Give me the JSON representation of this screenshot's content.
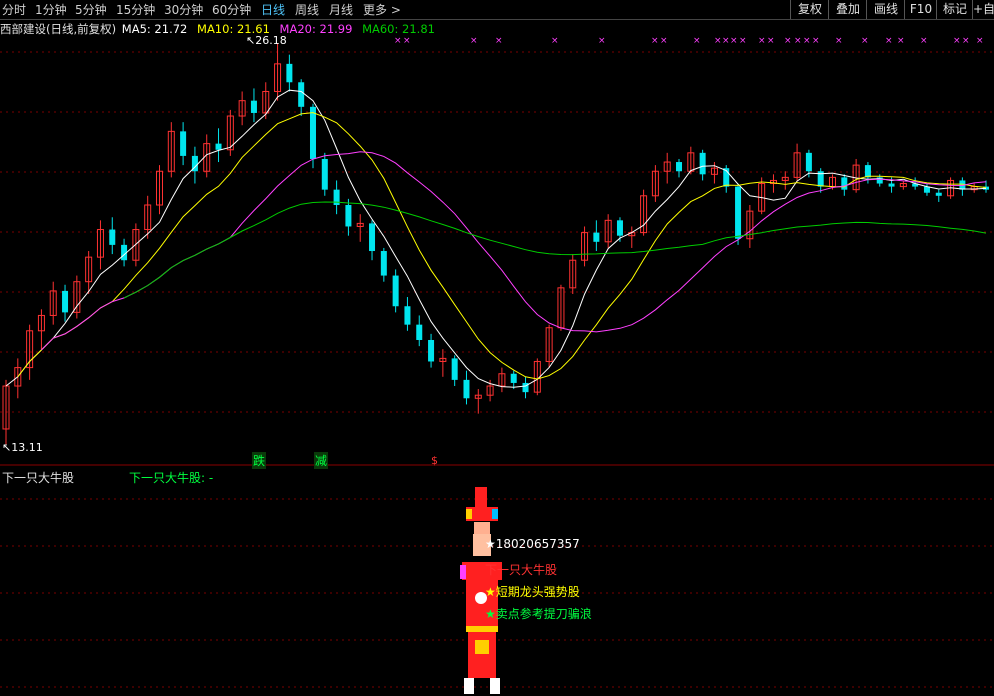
{
  "toolbar": {
    "periods": [
      "分时",
      "1分钟",
      "5分钟",
      "15分钟",
      "30分钟",
      "60分钟",
      "日线",
      "周线",
      "月线",
      "更多 >"
    ],
    "active_period": "日线",
    "right_buttons": [
      "复权",
      "叠加",
      "画线",
      "F10",
      "标记",
      "+自"
    ]
  },
  "info": {
    "stock": "西部建设(日线,前复权)",
    "ma5": "MA5: 21.72",
    "ma10": "MA10: 21.61",
    "ma20": "MA20: 21.99",
    "ma60": "MA60: 21.81"
  },
  "annotations": {
    "high": "26.18",
    "low": "13.11",
    "signal_die": "跌",
    "signal_jian": "减",
    "signal_dollar": "$"
  },
  "lower_panel": {
    "title": "下一只大牛股",
    "indicator": "下一只大牛股: -",
    "phone": "18020657357",
    "text1": "下一只大牛股",
    "text2": "短期龙头强势股",
    "text3": "卖点参考提刀骗浪"
  },
  "colors": {
    "up": "#ff3232",
    "down": "#00e5ee",
    "ma5": "#ffffff",
    "ma10": "#ffff00",
    "ma20": "#ff40ff",
    "ma60": "#00cc00",
    "grid": "#7a0000",
    "marker": "#ff40ff"
  },
  "chart_data": {
    "type": "candlestick",
    "series": [
      {
        "name": "MA5",
        "value": 21.72
      },
      {
        "name": "MA10",
        "value": 21.61
      },
      {
        "name": "MA20",
        "value": 21.99
      },
      {
        "name": "MA60",
        "value": 21.81
      }
    ],
    "high": 26.18,
    "low": 13.11,
    "candles": [
      [
        13.6,
        15.2,
        13.1,
        15.0
      ],
      [
        15.0,
        15.9,
        14.6,
        15.6
      ],
      [
        15.6,
        17.0,
        15.2,
        16.8
      ],
      [
        16.8,
        17.5,
        16.2,
        17.3
      ],
      [
        17.3,
        18.4,
        17.0,
        18.1
      ],
      [
        18.1,
        18.3,
        17.1,
        17.4
      ],
      [
        17.4,
        18.6,
        17.2,
        18.4
      ],
      [
        18.4,
        19.4,
        18.0,
        19.2
      ],
      [
        19.2,
        20.4,
        18.8,
        20.1
      ],
      [
        20.1,
        20.5,
        19.3,
        19.6
      ],
      [
        19.6,
        19.8,
        18.9,
        19.1
      ],
      [
        19.1,
        20.3,
        18.9,
        20.1
      ],
      [
        20.1,
        21.2,
        19.8,
        20.9
      ],
      [
        20.9,
        22.2,
        20.6,
        22.0
      ],
      [
        22.0,
        23.6,
        21.8,
        23.3
      ],
      [
        23.3,
        23.6,
        22.2,
        22.5
      ],
      [
        22.5,
        22.8,
        21.6,
        22.0
      ],
      [
        22.0,
        23.2,
        21.8,
        22.9
      ],
      [
        22.9,
        23.4,
        22.3,
        22.7
      ],
      [
        22.7,
        24.0,
        22.5,
        23.8
      ],
      [
        23.8,
        24.6,
        23.5,
        24.3
      ],
      [
        24.3,
        24.7,
        23.6,
        23.9
      ],
      [
        23.9,
        24.9,
        23.7,
        24.6
      ],
      [
        24.6,
        26.18,
        24.3,
        25.5
      ],
      [
        25.5,
        25.8,
        24.6,
        24.9
      ],
      [
        24.9,
        25.0,
        23.8,
        24.1
      ],
      [
        24.1,
        24.2,
        22.1,
        22.4
      ],
      [
        22.4,
        22.6,
        21.2,
        21.4
      ],
      [
        21.4,
        21.7,
        20.6,
        20.9
      ],
      [
        20.9,
        21.1,
        19.9,
        20.2
      ],
      [
        20.2,
        20.6,
        19.7,
        20.3
      ],
      [
        20.3,
        20.4,
        19.1,
        19.4
      ],
      [
        19.4,
        19.5,
        18.4,
        18.6
      ],
      [
        18.6,
        18.8,
        17.4,
        17.6
      ],
      [
        17.6,
        17.9,
        16.8,
        17.0
      ],
      [
        17.0,
        17.3,
        16.3,
        16.5
      ],
      [
        16.5,
        16.7,
        15.6,
        15.8
      ],
      [
        15.8,
        16.2,
        15.3,
        15.9
      ],
      [
        15.9,
        16.0,
        15.0,
        15.2
      ],
      [
        15.2,
        15.5,
        14.4,
        14.6
      ],
      [
        14.6,
        14.9,
        14.1,
        14.7
      ],
      [
        14.7,
        15.2,
        14.5,
        15.0
      ],
      [
        15.0,
        15.6,
        14.8,
        15.4
      ],
      [
        15.4,
        15.5,
        14.9,
        15.1
      ],
      [
        15.1,
        15.3,
        14.6,
        14.8
      ],
      [
        14.8,
        15.9,
        14.7,
        15.8
      ],
      [
        15.8,
        17.0,
        15.6,
        16.9
      ],
      [
        16.9,
        18.3,
        16.8,
        18.2
      ],
      [
        18.2,
        19.3,
        18.0,
        19.1
      ],
      [
        19.1,
        20.2,
        18.9,
        20.0
      ],
      [
        20.0,
        20.4,
        19.4,
        19.7
      ],
      [
        19.7,
        20.6,
        19.5,
        20.4
      ],
      [
        20.4,
        20.5,
        19.7,
        19.9
      ],
      [
        19.9,
        20.2,
        19.5,
        20.0
      ],
      [
        20.0,
        21.4,
        19.9,
        21.2
      ],
      [
        21.2,
        22.2,
        21.0,
        22.0
      ],
      [
        22.0,
        22.6,
        21.6,
        22.3
      ],
      [
        22.3,
        22.4,
        21.8,
        22.0
      ],
      [
        22.0,
        22.8,
        21.9,
        22.6
      ],
      [
        22.6,
        22.7,
        21.7,
        21.9
      ],
      [
        21.9,
        22.3,
        21.6,
        22.1
      ],
      [
        22.1,
        22.2,
        21.3,
        21.5
      ],
      [
        21.5,
        21.6,
        19.6,
        19.8
      ],
      [
        19.8,
        20.9,
        19.5,
        20.7
      ],
      [
        20.7,
        21.8,
        20.6,
        21.6
      ],
      [
        21.6,
        21.9,
        21.3,
        21.7
      ],
      [
        21.7,
        22.0,
        21.4,
        21.8
      ],
      [
        21.8,
        22.9,
        21.7,
        22.6
      ],
      [
        22.6,
        22.7,
        21.8,
        22.0
      ],
      [
        22.0,
        22.1,
        21.3,
        21.5
      ],
      [
        21.5,
        21.9,
        21.4,
        21.8
      ],
      [
        21.8,
        21.9,
        21.2,
        21.4
      ],
      [
        21.4,
        22.4,
        21.3,
        22.2
      ],
      [
        22.2,
        22.3,
        21.6,
        21.8
      ],
      [
        21.8,
        21.9,
        21.5,
        21.6
      ],
      [
        21.6,
        21.8,
        21.3,
        21.5
      ],
      [
        21.5,
        21.7,
        21.4,
        21.6
      ],
      [
        21.6,
        21.8,
        21.4,
        21.5
      ],
      [
        21.5,
        21.6,
        21.2,
        21.3
      ],
      [
        21.3,
        21.4,
        21.0,
        21.2
      ],
      [
        21.2,
        21.8,
        21.1,
        21.7
      ],
      [
        21.7,
        21.8,
        21.2,
        21.4
      ],
      [
        21.4,
        21.6,
        21.3,
        21.5
      ],
      [
        21.5,
        21.7,
        21.3,
        21.4
      ]
    ]
  }
}
